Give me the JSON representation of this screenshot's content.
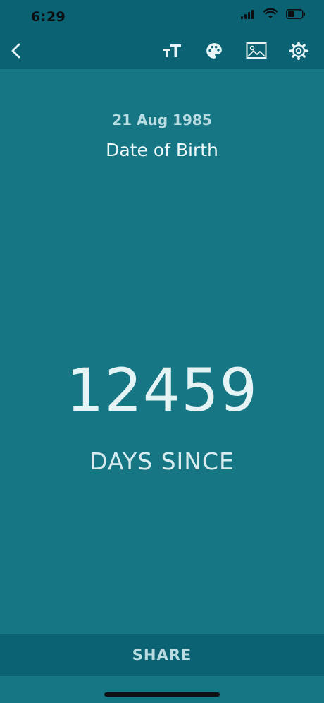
{
  "status_bar": {
    "time": "6:29"
  },
  "toolbar": {
    "icons": {
      "back": "chevron-left-icon",
      "text_size": "text-size-icon",
      "palette": "palette-icon",
      "image": "image-icon",
      "settings": "gear-icon"
    }
  },
  "event": {
    "date": "21 Aug 1985",
    "title": "Date of Birth"
  },
  "counter": {
    "value": "12459",
    "label": "DAYS SINCE"
  },
  "share": {
    "label": "SHARE"
  },
  "colors": {
    "background": "#167684",
    "bar": "#0a6273",
    "text_primary": "#eef8f9",
    "text_secondary": "#b9dde2"
  }
}
